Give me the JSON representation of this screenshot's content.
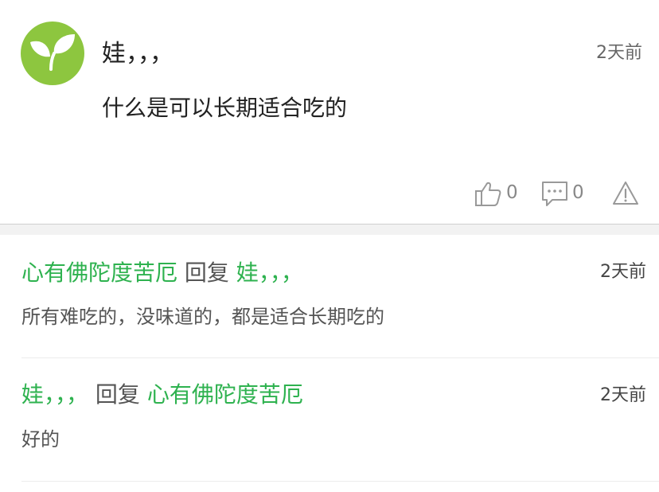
{
  "main_comment": {
    "author": "娃，，，",
    "time": "2天前",
    "text": "什么是可以长期适合吃的",
    "likes": "0",
    "replies": "0",
    "avatar_color": "#8dc63f"
  },
  "replies": [
    {
      "author": "心有佛陀度苦厄",
      "reply_word": "回复",
      "target": "娃，，，",
      "time": "2天前",
      "text": "所有难吃的，没味道的，都是适合长期吃的"
    },
    {
      "author": "娃，，，",
      "reply_word": "回复",
      "target": "心有佛陀度苦厄",
      "time": "2天前",
      "text": "好的"
    }
  ],
  "colors": {
    "accent_green": "#2eb24f",
    "text_dark": "#222222",
    "text_grey": "#555555"
  },
  "icons": [
    "leaf-icon",
    "thumbs-up-icon",
    "comment-icon",
    "warning-icon"
  ]
}
